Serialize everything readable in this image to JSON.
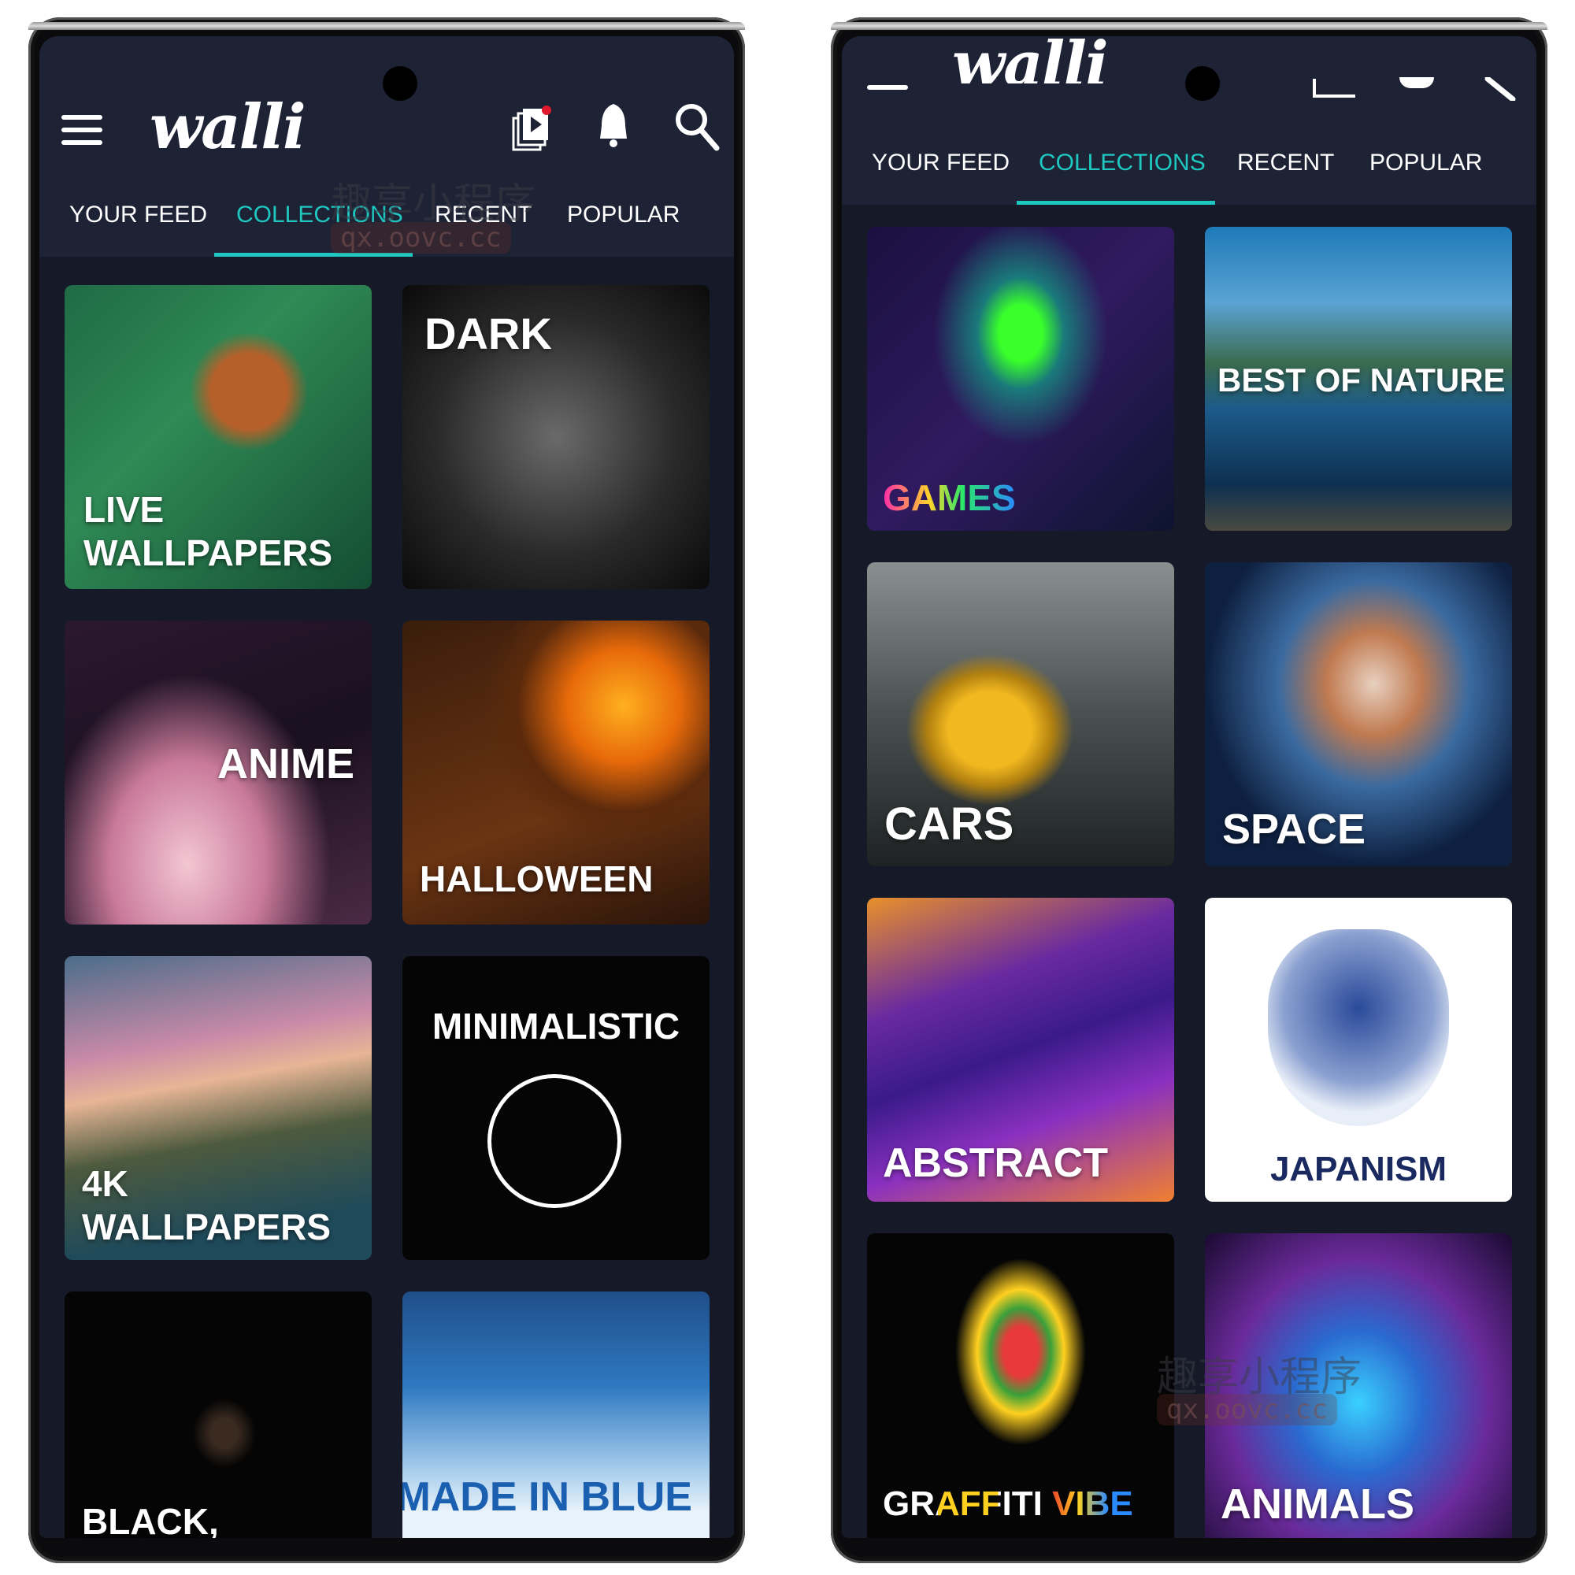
{
  "app": {
    "logo_text": "walli"
  },
  "colors": {
    "header_bg": "#1e2235",
    "content_bg": "#161a28",
    "accent": "#1ec8c0",
    "badge": "#e0182d"
  },
  "header": {
    "icons": [
      "menu-icon",
      "video-wallpaper-icon",
      "bell-icon",
      "search-icon"
    ]
  },
  "tabs": [
    {
      "label": "YOUR FEED",
      "active": false
    },
    {
      "label": "COLLECTIONS",
      "active": true
    },
    {
      "label": "RECENT",
      "active": false
    },
    {
      "label": "POPULAR",
      "active": false
    }
  ],
  "watermark": {
    "cn": "趣享小程序",
    "url": "qx.oovc.cc"
  },
  "left_collections": [
    {
      "label": "LIVE\nWALLPAPERS"
    },
    {
      "label": "DARK"
    },
    {
      "label": "ANIME"
    },
    {
      "label": "HALLOWEEN"
    },
    {
      "label": "4K\nWALLPAPERS"
    },
    {
      "label": "MINIMALISTIC"
    },
    {
      "label": "BLACK,"
    },
    {
      "label": "MADE IN BLUE"
    }
  ],
  "right_collections": [
    {
      "label": "GAMES"
    },
    {
      "label": "BEST OF NATURE"
    },
    {
      "label": "CARS"
    },
    {
      "label": "SPACE"
    },
    {
      "label": "ABSTRACT"
    },
    {
      "label": "JAPANISM"
    },
    {
      "label": "GRAFFITI VIBE"
    },
    {
      "label": "ANIMALS"
    }
  ]
}
